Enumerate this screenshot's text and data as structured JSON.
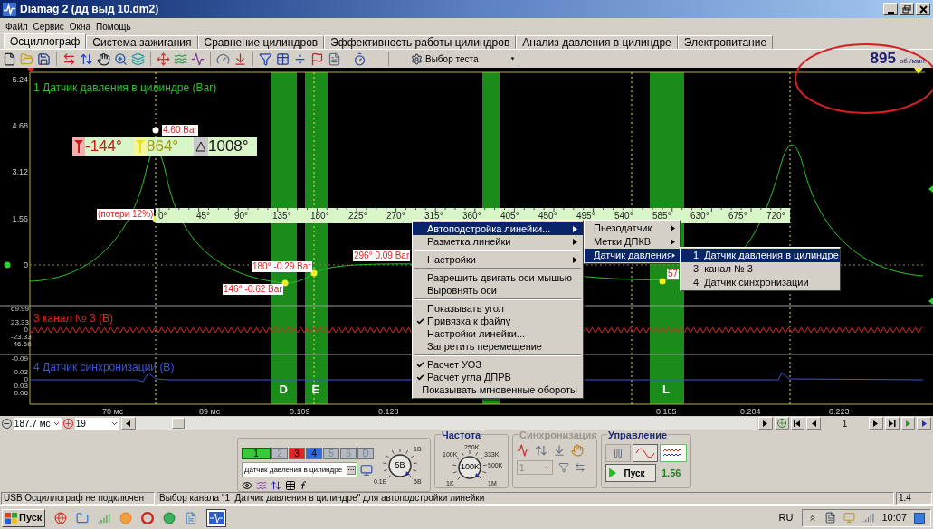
{
  "window": {
    "title": "Diamag 2 (дд выд 10.dm2)"
  },
  "menu": [
    "Файл",
    "Сервис",
    "Окна",
    "Помощь"
  ],
  "tabs": [
    {
      "label": "Осциллограф",
      "selected": true
    },
    {
      "label": "Система зажигания",
      "selected": false
    },
    {
      "label": "Сравнение цилиндров",
      "selected": false
    },
    {
      "label": "Эффективность работы цилиндров",
      "selected": false
    },
    {
      "label": "Анализ давления в цилиндре",
      "selected": false
    },
    {
      "label": "Электропитание",
      "selected": false
    }
  ],
  "toolbar": {
    "test_select": "Выбор теста",
    "rpm": "895",
    "rpm_unit": "об./мин."
  },
  "plot": {
    "channels": [
      {
        "title": "1 Датчик давления в цилиндре (Bar)",
        "color": "#2fbf2f",
        "yticks": [
          "6.24",
          "4.68",
          "3.12",
          "1.56",
          "0"
        ]
      },
      {
        "title": "3 канал № 3 (В)",
        "color": "#e02424",
        "yticks": [
          "69.99",
          "23.33",
          "0",
          "-23.33",
          "-46.66"
        ]
      },
      {
        "title": "4 Датчик синхронизации (В)",
        "color": "#3a55d8",
        "yticks": [
          "-0.09",
          "-0.03",
          "0",
          "0.03",
          "0.06"
        ]
      }
    ],
    "xticks": [
      "70 мс",
      "89 мс",
      "0.109",
      "0.128",
      "0.185",
      "0.204",
      "0.223"
    ],
    "band_labels": [
      "D",
      "E",
      "L"
    ],
    "readout": {
      "cursor_1": "-144°",
      "cursor_2": "864°",
      "delta": "1008°"
    },
    "ruler": [
      "0°",
      "45°",
      "90°",
      "135°",
      "180°",
      "225°",
      "270°",
      "315°",
      "360°",
      "405°",
      "450°",
      "495°",
      "540°",
      "585°",
      "630°",
      "675°",
      "720°"
    ],
    "point_labels": [
      "4.60 Bar",
      "(потери 12%)",
      "296° 0.09 Bar",
      "180° -0.29 Bar",
      "146° -0.62 Bar",
      "57"
    ]
  },
  "context_menu": {
    "items": [
      {
        "kind": "item",
        "label": "Автоподстройка линейки...",
        "checked": false,
        "submenu": true,
        "selected": true
      },
      {
        "kind": "item",
        "label": "Разметка линейки",
        "checked": false,
        "submenu": true,
        "selected": false
      },
      {
        "kind": "separator"
      },
      {
        "kind": "item",
        "label": "Настройки",
        "checked": false,
        "submenu": true,
        "selected": false
      },
      {
        "kind": "separator"
      },
      {
        "kind": "item",
        "label": "Разрешить двигать оси мышью",
        "checked": false,
        "submenu": false,
        "selected": false
      },
      {
        "kind": "item",
        "label": "Выровнять оси",
        "checked": false,
        "submenu": false,
        "selected": false
      },
      {
        "kind": "separator"
      },
      {
        "kind": "item",
        "label": "Показывать угол",
        "checked": false,
        "submenu": false,
        "selected": false
      },
      {
        "kind": "item",
        "label": "Привязка к файлу",
        "checked": true,
        "submenu": false,
        "selected": false
      },
      {
        "kind": "item",
        "label": "Настройки линейки...",
        "checked": false,
        "submenu": false,
        "selected": false
      },
      {
        "kind": "item",
        "label": "Запретить перемещение",
        "checked": false,
        "submenu": false,
        "selected": false
      },
      {
        "kind": "separator"
      },
      {
        "kind": "item",
        "label": "Расчет УОЗ",
        "checked": true,
        "submenu": false,
        "selected": false
      },
      {
        "kind": "item",
        "label": "Расчет угла ДПРВ",
        "checked": true,
        "submenu": false,
        "selected": false
      },
      {
        "kind": "item",
        "label": "Показывать мгновенные обороты",
        "checked": false,
        "submenu": false,
        "selected": false
      }
    ],
    "submenu": [
      {
        "label": "Пьезодатчик",
        "selected": false
      },
      {
        "label": "Метки ДПКВ",
        "selected": false
      },
      {
        "label": "Датчик давления",
        "selected": true
      }
    ],
    "channel_submenu": [
      {
        "number": "1",
        "label": "Датчик давления в цилиндре",
        "selected": true
      },
      {
        "number": "3",
        "label": "канал № 3",
        "selected": false
      },
      {
        "number": "4",
        "label": "Датчик синхронизации",
        "selected": false
      }
    ]
  },
  "view_controls": {
    "time_scale": "187.7 мс",
    "zoom": "19",
    "page": "1"
  },
  "channel_panel": {
    "buttons": [
      {
        "label": "1",
        "color": "#3cc83c",
        "enabled": true,
        "selected": true
      },
      {
        "label": "2",
        "color": "#b4bac4",
        "enabled": false,
        "selected": false
      },
      {
        "label": "3",
        "color": "#e02424",
        "enabled": true,
        "selected": false
      },
      {
        "label": "4",
        "color": "#2f6ae0",
        "enabled": true,
        "selected": false
      },
      {
        "label": "5",
        "color": "#b4bac4",
        "enabled": false,
        "selected": false
      },
      {
        "label": "6",
        "color": "#b4bac4",
        "enabled": false,
        "selected": false
      },
      {
        "label": "D",
        "color": "#b4bac4",
        "enabled": false,
        "selected": false
      }
    ],
    "channel_name": "Датчик давления в цилиндре",
    "knob": {
      "value": "5В",
      "scale": [
        "1В",
        "0.1В",
        "5В"
      ]
    }
  },
  "frequency": {
    "title": "Частота",
    "value": "100K",
    "scale": [
      "250K",
      "100K",
      "333K",
      "500K",
      "1K",
      "1M"
    ]
  },
  "sync": {
    "title": "Синхронизация",
    "enabled": false,
    "channel": "1"
  },
  "control": {
    "title": "Управление",
    "start": "Пуск",
    "reading": "1.56"
  },
  "status_bar": [
    "USB Осциллограф не подключен",
    "Выбор канала \"1  Датчик давления в цилиндре\" для автоподстройки линейки",
    "1.4"
  ],
  "taskbar": {
    "start": "Пуск",
    "language": "RU",
    "time": "10:07"
  }
}
